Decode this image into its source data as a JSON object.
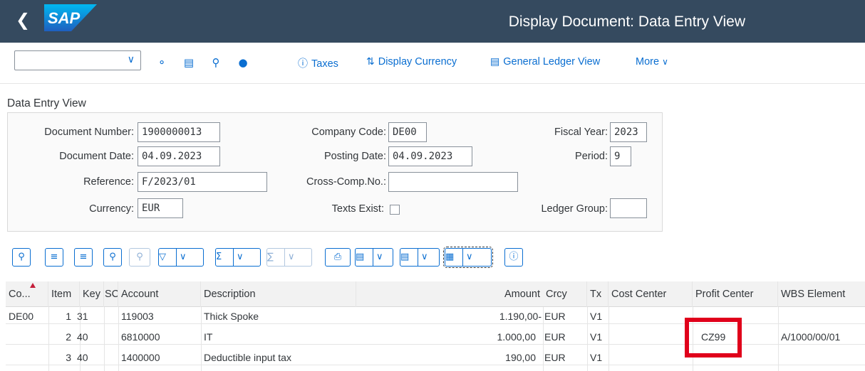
{
  "shell": {
    "back_icon": "chevron-left-icon",
    "logo_text": "SAP",
    "title": "Display Document: Data Entry View",
    "colors": {
      "shell_bg": "#354a5f",
      "logo_blue": "#0a6ed1",
      "highlight": "#e0001b"
    }
  },
  "toolbar": {
    "variant_value": "",
    "icons": [
      "edit-glasses-icon",
      "export-icon",
      "zoom-icon",
      "hat-icon"
    ],
    "taxes_label": "Taxes",
    "display_currency_label": "Display Currency",
    "gl_view_label": "General Ledger View",
    "more_label": "More"
  },
  "section": {
    "title": "Data Entry View"
  },
  "form": {
    "document_number": {
      "label": "Document Number:",
      "value": "1900000013"
    },
    "company_code": {
      "label": "Company Code:",
      "value": "DE00"
    },
    "fiscal_year": {
      "label": "Fiscal Year:",
      "value": "2023"
    },
    "document_date": {
      "label": "Document Date:",
      "value": "04.09.2023"
    },
    "posting_date": {
      "label": "Posting Date:",
      "value": "04.09.2023"
    },
    "period": {
      "label": "Period:",
      "value": "9"
    },
    "reference": {
      "label": "Reference:",
      "value": "F/2023/01"
    },
    "cross_comp": {
      "label": "Cross-Comp.No.:",
      "value": ""
    },
    "currency": {
      "label": "Currency:",
      "value": "EUR"
    },
    "texts_exist": {
      "label": "Texts Exist:",
      "checked": false
    },
    "ledger_group": {
      "label": "Ledger Group:",
      "value": ""
    }
  },
  "grid": {
    "headers": {
      "co": "Co...",
      "item": "Item",
      "key": "Key",
      "sg": "SC",
      "account": "Account",
      "description": "Description",
      "amount": "Amount",
      "crcy": "Crcy",
      "tx": "Tx",
      "cost_center": "Cost Center",
      "profit_center": "Profit Center",
      "wbs": "WBS Element"
    },
    "rows": [
      {
        "co": "DE00",
        "item": "1",
        "key": "31",
        "account": "119003",
        "description": "Thick Spoke",
        "amount": "1.190,00-",
        "crcy": "EUR",
        "tx": "V1",
        "cost_center": "",
        "profit_center": "",
        "wbs": ""
      },
      {
        "co": "",
        "item": "2",
        "key": "40",
        "account": "6810000",
        "description": "IT",
        "amount": "1.000,00",
        "crcy": "EUR",
        "tx": "V1",
        "cost_center": "",
        "profit_center": "CZ99",
        "wbs": "A/1000/00/01"
      },
      {
        "co": "",
        "item": "3",
        "key": "40",
        "account": "1400000",
        "description": "Deductible input tax",
        "amount": "190,00",
        "crcy": "EUR",
        "tx": "V1",
        "cost_center": "",
        "profit_center": "",
        "wbs": ""
      }
    ]
  }
}
